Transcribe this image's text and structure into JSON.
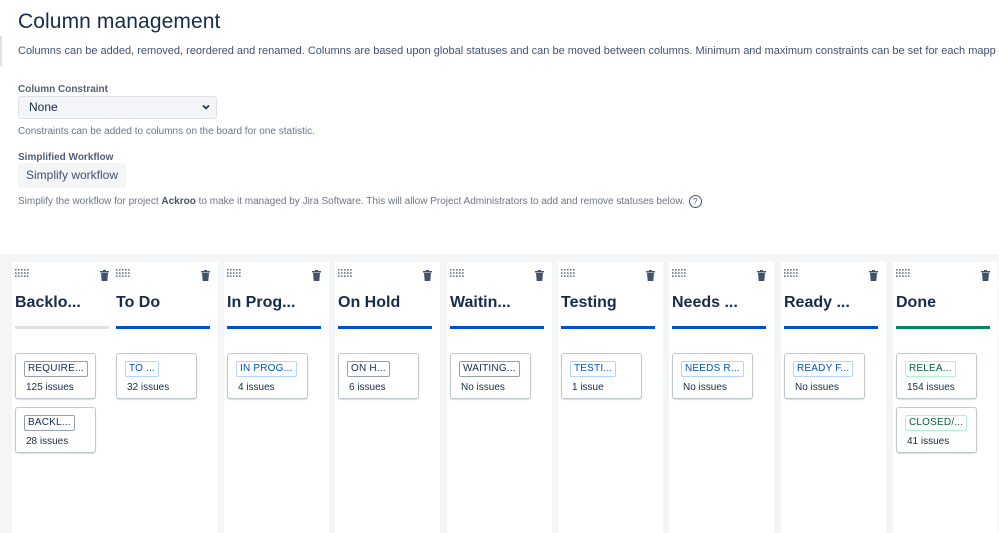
{
  "title": "Column management",
  "description": "Columns can be added, removed, reordered and renamed. Columns are based upon global statuses and can be moved between columns. Minimum and maximum constraints can be set for each mapp",
  "constraint": {
    "label": "Column Constraint",
    "value": "None",
    "help": "Constraints can be added to columns on the board for one statistic."
  },
  "workflow": {
    "label": "Simplified Workflow",
    "button": "Simplify workflow",
    "help_before": "Simplify the workflow for project ",
    "project": "Ackroo",
    "help_after": " to make it managed by Jira Software. This will allow Project Administrators to add and remove statuses below.",
    "help_icon": "question-circle-icon"
  },
  "colors": {
    "accent": "#0052cc",
    "done": "#00875a",
    "backlog": "#dfe1e6"
  },
  "columns": [
    {
      "name": "Backlo...",
      "bar": "#dfe1e6",
      "cards": [
        {
          "tag": "REQUIRE...",
          "tone": "gray",
          "count": "125 issues"
        },
        {
          "tag": "BACKL...",
          "tone": "gray",
          "count": "28 issues"
        }
      ]
    },
    {
      "name": "To Do",
      "bar": "#0052cc",
      "cards": [
        {
          "tag": "TO ...",
          "tone": "blue",
          "count": "32 issues"
        }
      ]
    },
    {
      "name": "In Prog...",
      "bar": "#0052cc",
      "cards": [
        {
          "tag": "IN PROG...",
          "tone": "blue",
          "count": "4 issues"
        }
      ]
    },
    {
      "name": "On Hold",
      "bar": "#0052cc",
      "cards": [
        {
          "tag": "ON H...",
          "tone": "gray",
          "count": "6 issues"
        }
      ]
    },
    {
      "name": "Waitin...",
      "bar": "#0052cc",
      "cards": [
        {
          "tag": "WAITING...",
          "tone": "gray",
          "count": "No issues"
        }
      ]
    },
    {
      "name": "Testing",
      "bar": "#0052cc",
      "cards": [
        {
          "tag": "TESTI...",
          "tone": "blue",
          "count": "1 issue"
        }
      ]
    },
    {
      "name": "Needs ...",
      "bar": "#0052cc",
      "cards": [
        {
          "tag": "NEEDS R...",
          "tone": "blue",
          "count": "No issues"
        }
      ]
    },
    {
      "name": "Ready ...",
      "bar": "#0052cc",
      "cards": [
        {
          "tag": "READY F...",
          "tone": "blue",
          "count": "No issues"
        }
      ]
    },
    {
      "name": "Done",
      "bar": "#00875a",
      "cards": [
        {
          "tag": "RELEA...",
          "tone": "green",
          "count": "154 issues"
        },
        {
          "tag": "CLOSED/...",
          "tone": "green",
          "count": "41 issues"
        }
      ]
    }
  ]
}
